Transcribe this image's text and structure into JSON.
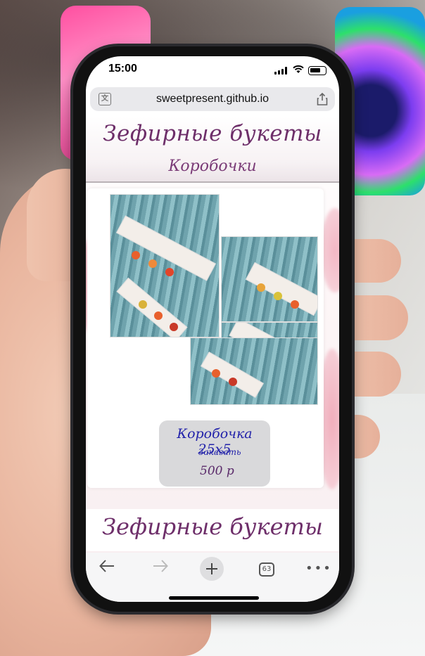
{
  "status_bar": {
    "time": "15:00"
  },
  "browser": {
    "url": "sweetpresent.github.io",
    "tab_count": "63"
  },
  "page": {
    "header_title": "Зефирные букеты",
    "header_subtitle": "Коробочки",
    "product": {
      "name": "Коробочка 25x5",
      "order_label": "Заказать",
      "price": "500 р"
    },
    "footer_title": "Зефирные букеты"
  },
  "colors": {
    "title": "#6e2f6a",
    "link": "#2222aa",
    "price_box": "#d9d9db"
  }
}
